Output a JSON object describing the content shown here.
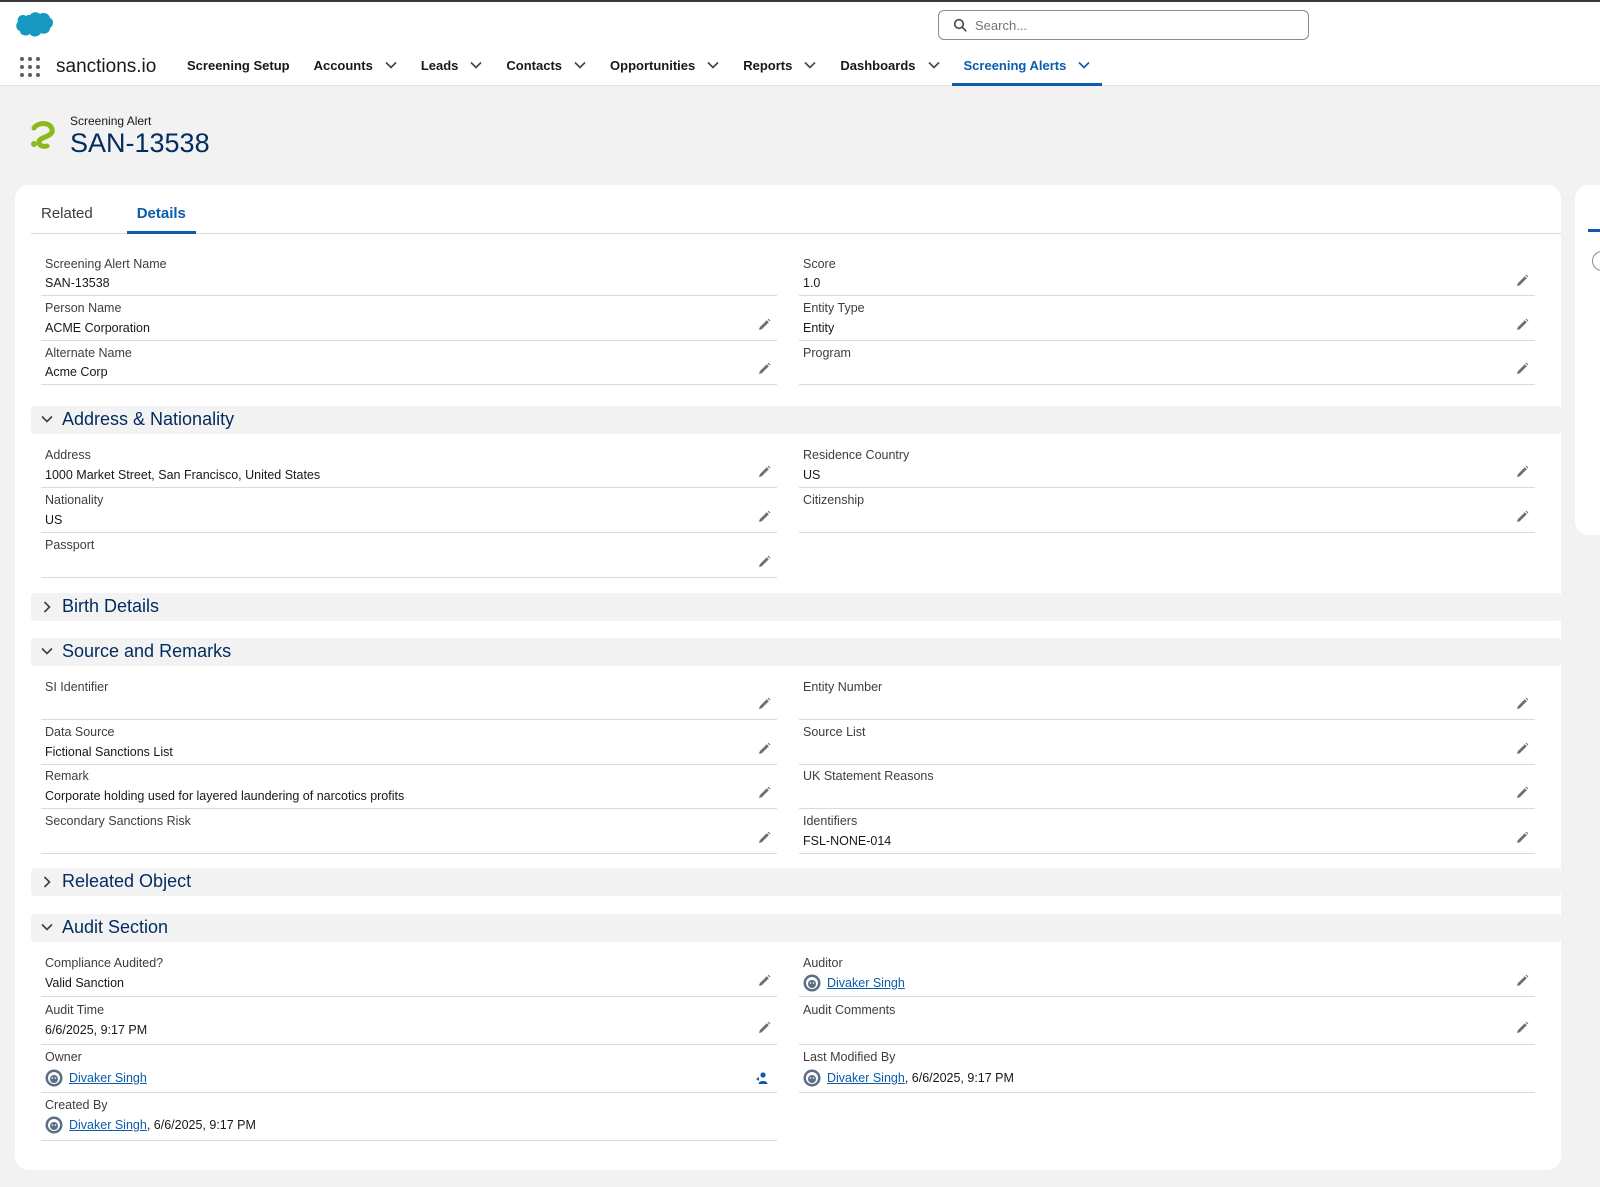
{
  "header": {
    "search_placeholder": "Search...",
    "app_name": "sanctions.io",
    "nav": [
      {
        "label": "Screening Setup"
      },
      {
        "label": "Accounts"
      },
      {
        "label": "Leads"
      },
      {
        "label": "Contacts"
      },
      {
        "label": "Opportunities"
      },
      {
        "label": "Reports"
      },
      {
        "label": "Dashboards"
      },
      {
        "label": "Screening Alerts"
      }
    ]
  },
  "record": {
    "type": "Screening Alert",
    "name": "SAN-13538"
  },
  "tabs": {
    "related": "Related",
    "details": "Details"
  },
  "fields": {
    "screening_alert_name": {
      "label": "Screening Alert Name",
      "value": "SAN-13538"
    },
    "score": {
      "label": "Score",
      "value": "1.0"
    },
    "person_name": {
      "label": "Person Name",
      "value": "ACME Corporation"
    },
    "entity_type": {
      "label": "Entity Type",
      "value": "Entity"
    },
    "alternate_name": {
      "label": "Alternate Name",
      "value": "Acme Corp"
    },
    "program": {
      "label": "Program",
      "value": ""
    }
  },
  "sections": {
    "address": {
      "title": "Address & Nationality",
      "address": {
        "label": "Address",
        "value": "1000 Market Street, San Francisco, United States"
      },
      "residence_country": {
        "label": "Residence Country",
        "value": "US"
      },
      "nationality": {
        "label": "Nationality",
        "value": "US"
      },
      "citizenship": {
        "label": "Citizenship",
        "value": ""
      },
      "passport": {
        "label": "Passport",
        "value": ""
      }
    },
    "birth": {
      "title": "Birth Details"
    },
    "source": {
      "title": "Source and Remarks",
      "si_identifier": {
        "label": "SI Identifier",
        "value": ""
      },
      "entity_number": {
        "label": "Entity Number",
        "value": ""
      },
      "data_source": {
        "label": "Data Source",
        "value": "Fictional Sanctions List"
      },
      "source_list": {
        "label": "Source List",
        "value": ""
      },
      "remark": {
        "label": "Remark",
        "value": "Corporate holding used for layered laundering of narcotics profits"
      },
      "uk_statement": {
        "label": "UK Statement Reasons",
        "value": ""
      },
      "secondary_risk": {
        "label": "Secondary Sanctions Risk",
        "value": ""
      },
      "identifiers": {
        "label": "Identifiers",
        "value": "FSL-NONE-014"
      }
    },
    "related_object": {
      "title": "Releated Object"
    },
    "audit": {
      "title": "Audit Section",
      "compliance": {
        "label": "Compliance Audited?",
        "value": "Valid Sanction"
      },
      "auditor": {
        "label": "Auditor",
        "value": "Divaker Singh"
      },
      "audit_time": {
        "label": "Audit Time",
        "value": "6/6/2025, 9:17 PM"
      },
      "audit_comments": {
        "label": "Audit Comments",
        "value": ""
      },
      "owner": {
        "label": "Owner",
        "value": "Divaker Singh"
      },
      "last_modified": {
        "label": "Last Modified By",
        "user": "Divaker Singh",
        "date": ", 6/6/2025, 9:17 PM"
      },
      "created_by": {
        "label": "Created By",
        "user": "Divaker Singh",
        "date": ", 6/6/2025, 9:17 PM"
      }
    }
  },
  "colors": {
    "brand_blue": "#0b5cab",
    "heading_navy": "#032d60",
    "cloud_blue": "#1798c1",
    "logo_green": "#8cb81c"
  }
}
